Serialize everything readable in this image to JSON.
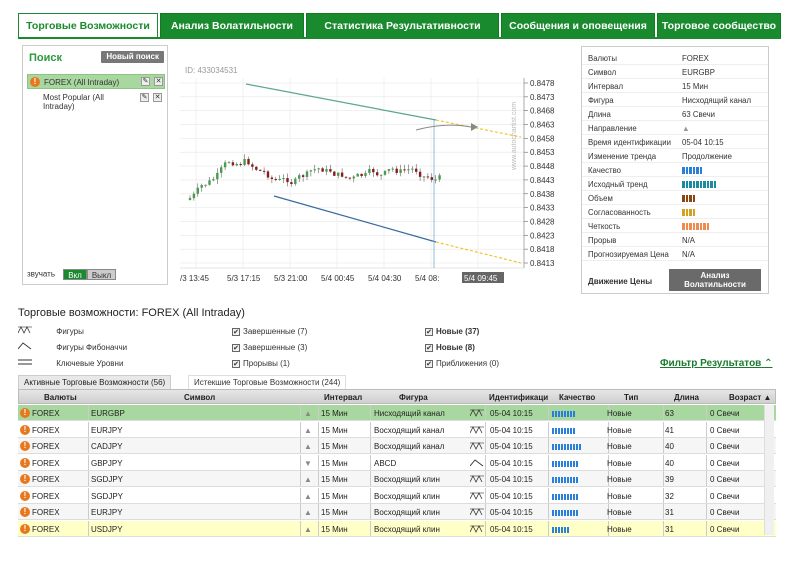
{
  "tabs": [
    "Торговые Возможности",
    "Анализ Волатильности",
    "Статистика Результативности",
    "Сообщения и оповещения",
    "Торговое сообщество"
  ],
  "search": {
    "title": "Поиск",
    "new_search": "Новый поиск",
    "items": [
      "FOREX (All Intraday)",
      "Most Popular (All Intraday)"
    ],
    "sound_label": "звучать",
    "on": "Вкл",
    "off": "Выкл"
  },
  "chart": {
    "id_label": "ID: 433034531",
    "watermark": "www.autochartist.com",
    "price_ticks": [
      "0.8478",
      "0.8473",
      "0.8468",
      "0.8463",
      "0.8458",
      "0.8453",
      "0.8448",
      "0.8443",
      "0.8438",
      "0.8433",
      "0.8428",
      "0.8423",
      "0.8418",
      "0.8413"
    ],
    "time_ticks": [
      "/3 13:45",
      "5/3 17:15",
      "5/3 21:00",
      "5/4 00:45",
      "5/4 04:30",
      "5/4 08:",
      "5/4 09:45"
    ]
  },
  "info": {
    "rows": [
      {
        "k": "Валюты",
        "v": "FOREX"
      },
      {
        "k": "Символ",
        "v": "EURGBP"
      },
      {
        "k": "Интервал",
        "v": "15 Мин"
      },
      {
        "k": "Фигура",
        "v": "Нисходящий канал"
      },
      {
        "k": "Длина",
        "v": "63 Свечи"
      },
      {
        "k": "Направление",
        "v": "▲"
      },
      {
        "k": "Время идентификации",
        "v": "05-04 10:15"
      },
      {
        "k": "Изменение тренда",
        "v": "Продолжение"
      },
      {
        "k": "Качество",
        "v": ""
      },
      {
        "k": "Исходный тренд",
        "v": ""
      },
      {
        "k": "Объем",
        "v": ""
      },
      {
        "k": "Согласованность",
        "v": ""
      },
      {
        "k": "Четкость",
        "v": ""
      },
      {
        "k": "Прорыв",
        "v": "N/A"
      },
      {
        "k": "Прогнозируемая Цена",
        "v": "N/A"
      }
    ],
    "price_move": "Движение Цены",
    "vol_btn": "Анализ Волатильности",
    "colors": {
      "quality": "#2a7fd8",
      "trend": "#1a8aa0",
      "volume": "#8b4513",
      "consistency": "#d4a020",
      "clarity": "#f08a50"
    }
  },
  "opps": {
    "title": "Торговые возможности: FOREX (All Intraday)",
    "legend": {
      "figures": "Фигуры",
      "fib": "Фигуры Фибоначчи",
      "levels": "Ключевые Уровни",
      "completed7": "Завершенные (7)",
      "completed3": "Завершенные (3)",
      "breakouts": "Прорывы (1)",
      "new37": "Новые (37)",
      "new8": "Новые (8)",
      "approach": "Приближения (0)"
    },
    "filter": "Фильтр Результатов",
    "subtabs": [
      "Активные Торговые Возможности (56)",
      "Истекшие Торговые Возможности (244)"
    ],
    "headers": [
      "Валюты",
      "Символ",
      "Интервал",
      "Фигура",
      "Идентификаци",
      "Качество",
      "Тип",
      "Длина",
      "Возраст ▲"
    ],
    "rows": [
      {
        "cur": "FOREX",
        "sym": "EURGBP",
        "dir": "▲",
        "int": "15 Мин",
        "fig": "Нисходящий канал",
        "id": "05-04 10:15",
        "q": 8,
        "type": "Новые",
        "len": "63",
        "age": "0 Свечи"
      },
      {
        "cur": "FOREX",
        "sym": "EURJPY",
        "dir": "▲",
        "int": "15 Мин",
        "fig": "Восходящий канал",
        "id": "05-04 10:15",
        "q": 8,
        "type": "Новые",
        "len": "41",
        "age": "0 Свечи"
      },
      {
        "cur": "FOREX",
        "sym": "CADJPY",
        "dir": "▲",
        "int": "15 Мин",
        "fig": "Восходящий канал",
        "id": "05-04 10:15",
        "q": 10,
        "type": "Новые",
        "len": "40",
        "age": "0 Свечи"
      },
      {
        "cur": "FOREX",
        "sym": "GBPJPY",
        "dir": "▼",
        "int": "15 Мин",
        "fig": "ABCD",
        "id": "05-04 10:15",
        "q": 9,
        "type": "Новые",
        "len": "40",
        "age": "0 Свечи"
      },
      {
        "cur": "FOREX",
        "sym": "SGDJPY",
        "dir": "▲",
        "int": "15 Мин",
        "fig": "Восходящий клин",
        "id": "05-04 10:15",
        "q": 9,
        "type": "Новые",
        "len": "39",
        "age": "0 Свечи"
      },
      {
        "cur": "FOREX",
        "sym": "SGDJPY",
        "dir": "▲",
        "int": "15 Мин",
        "fig": "Восходящий клин",
        "id": "05-04 10:15",
        "q": 9,
        "type": "Новые",
        "len": "32",
        "age": "0 Свечи"
      },
      {
        "cur": "FOREX",
        "sym": "EURJPY",
        "dir": "▲",
        "int": "15 Мин",
        "fig": "Восходящий клин",
        "id": "05-04 10:15",
        "q": 9,
        "type": "Новые",
        "len": "31",
        "age": "0 Свечи"
      },
      {
        "cur": "FOREX",
        "sym": "USDJPY",
        "dir": "▲",
        "int": "15 Мин",
        "fig": "Восходящий клин",
        "id": "05-04 10:15",
        "q": 6,
        "type": "Новые",
        "len": "31",
        "age": "0 Свечи"
      }
    ]
  }
}
